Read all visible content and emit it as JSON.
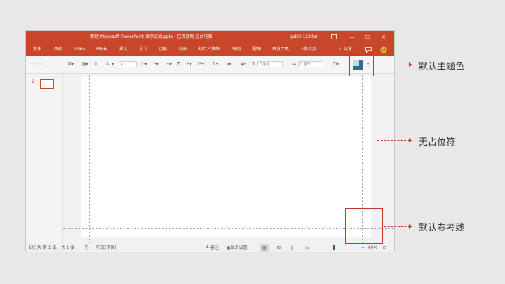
{
  "titlebar": {
    "title": "新建 Microsoft PowerPoint 演示文稿.pptx  -  已保存到 这台电脑",
    "user": "goblin123dan",
    "ribbon_display_icon": "ribbon-display-icon",
    "minimize": "—",
    "maximize": "☐",
    "close": "✕"
  },
  "menu": {
    "items": [
      "文件",
      "开始",
      "iSlide",
      "iSlide",
      "插入",
      "设计",
      "切换",
      "动画",
      "幻灯片放映",
      "审阅",
      "视图",
      "开发工具"
    ],
    "tell_me": "告诉我",
    "share": "共享",
    "comments_icon": "comment-icon",
    "smiley": "☺"
  },
  "ribbon": {
    "width_field": "0 厘米",
    "height_field": "0 厘米",
    "font_label": "A"
  },
  "thumbnails": {
    "slide_number": "1"
  },
  "status": {
    "slide_info": "幻灯片 第 1 张，共 1 张",
    "language": "中文(中国)",
    "notes": "备注",
    "display_settings": "显示设置",
    "zoom_minus": "-",
    "zoom_plus": "+",
    "zoom_percent": "60%",
    "zoom_level": 0.6
  },
  "annotations": {
    "theme_color": "默认主题色",
    "no_placeholder": "无占位符",
    "guides": "默认参考线"
  },
  "colors": {
    "accent": "#c8472b",
    "annotation": "#c0392b"
  }
}
